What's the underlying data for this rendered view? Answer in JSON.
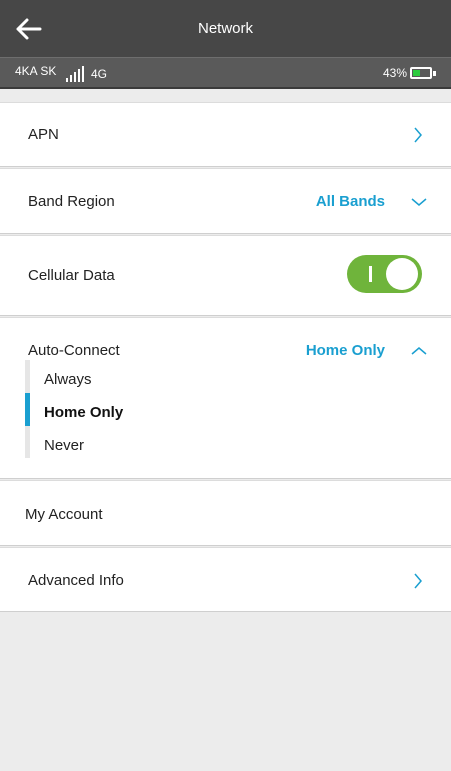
{
  "header": {
    "title": "Network"
  },
  "status": {
    "carrier": "4KA SK",
    "network": "4G",
    "battery_text": "43%",
    "battery_level": 0.43
  },
  "rows": {
    "apn": {
      "label": "APN"
    },
    "band": {
      "label": "Band Region",
      "value": "All Bands"
    },
    "cellular": {
      "label": "Cellular Data",
      "enabled": true
    },
    "auto": {
      "label": "Auto-Connect",
      "value": "Home Only",
      "options": [
        "Always",
        "Home Only",
        "Never"
      ],
      "selected_index": 1
    },
    "account": {
      "label": "My Account"
    },
    "advanced": {
      "label": "Advanced Info"
    }
  },
  "colors": {
    "accent": "#1a9fd0",
    "toggle_on": "#6fb43b",
    "header_bg": "#474747",
    "battery_fill": "#2ecc40"
  }
}
